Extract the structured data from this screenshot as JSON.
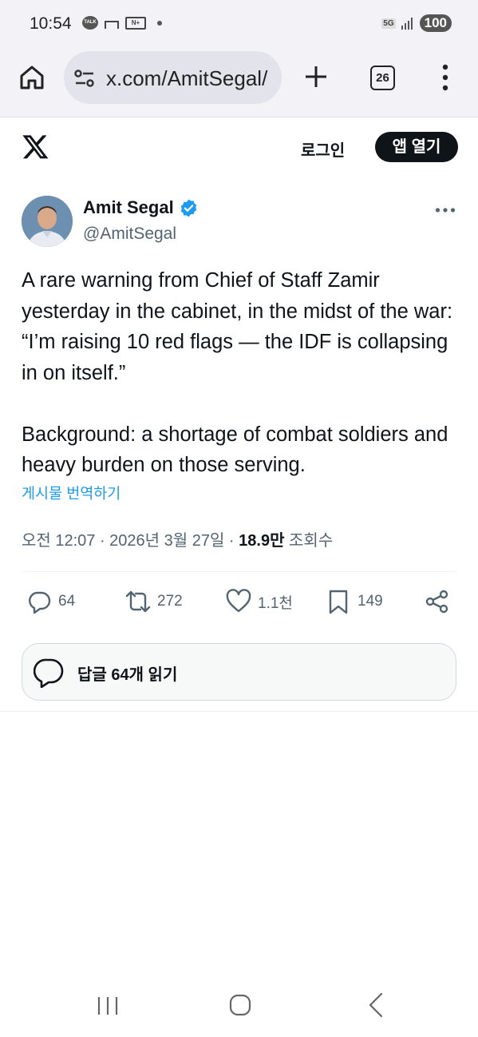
{
  "status_bar": {
    "time": "10:54",
    "talk_badge": "TALK",
    "network": "5G",
    "battery": "100"
  },
  "browser": {
    "url": "x.com/AmitSegal/",
    "tab_count": "26"
  },
  "header": {
    "login_label": "로그인",
    "open_app_label": "앱 열기"
  },
  "tweet": {
    "author_name": "Amit Segal",
    "author_handle": "@AmitSegal",
    "text": "A rare warning from Chief of Staff Zamir yesterday in the cabinet, in the midst of the war: “I’m raising 10 red flags — the IDF is collapsing in on itself.”\n\nBackground: a shortage of combat soldiers and heavy burden on those serving.",
    "translate_label": "게시물 번역하기",
    "timestamp": "오전 12:07 · 2026년 3월 27일 · ",
    "views_count": "18.9만",
    "views_label": " 조회수"
  },
  "actions": {
    "replies": "64",
    "reposts": "272",
    "likes": "1.1천",
    "bookmarks": "149"
  },
  "reply_button": {
    "label": "답글 64개 읽기"
  },
  "colors": {
    "accent": "#1d9bf0",
    "text": "#0f1419",
    "muted": "#536471"
  }
}
